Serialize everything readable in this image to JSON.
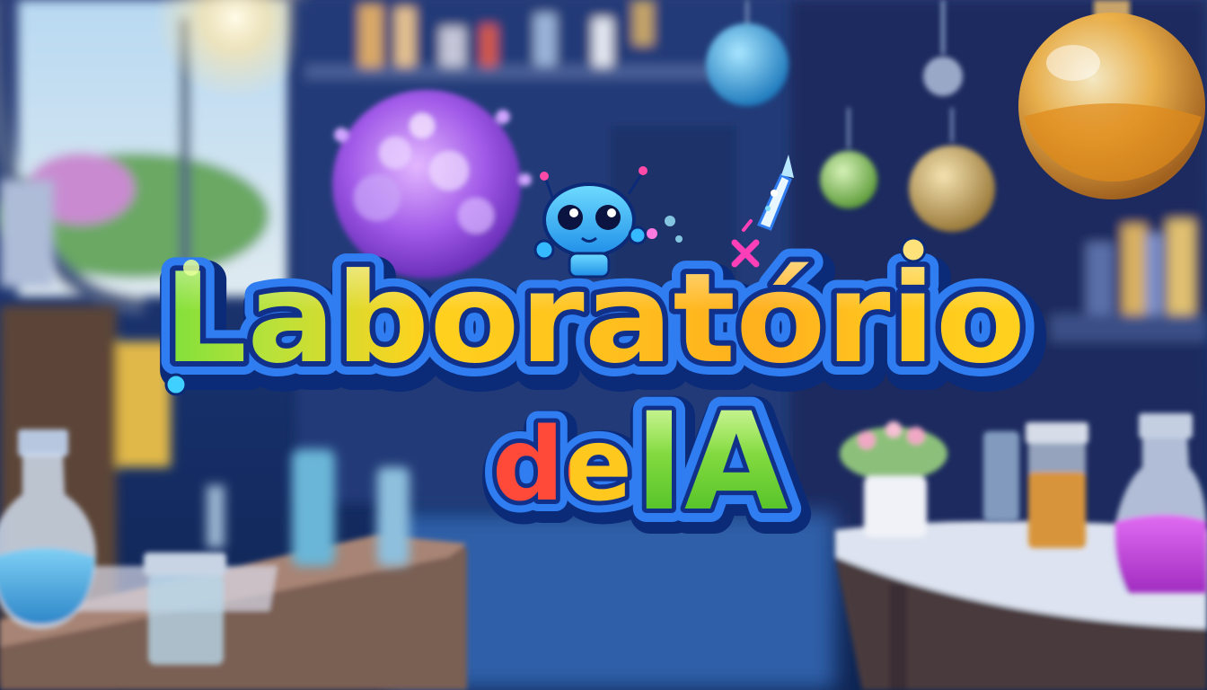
{
  "logo": {
    "line1": "Laboratório",
    "line2_word": "de",
    "line2_highlight": "IA"
  },
  "colors": {
    "outline_dark": "#0b2a78",
    "outline_blue": "#2f7df0",
    "letter_green": "#7ee03a",
    "letter_yellow": "#ffd21e",
    "letter_orange": "#ff9a1a",
    "letter_red": "#ff4a3a",
    "flask_orange": "#f2a23a",
    "flask_magenta": "#c43ad8",
    "flask_blue": "#6fb8ee",
    "robot_cyan": "#35b9ff"
  },
  "icons": [
    "robot-mascot",
    "magic-wand",
    "multiply-symbol",
    "virus-orb",
    "round-flask",
    "hanging-ornament"
  ]
}
